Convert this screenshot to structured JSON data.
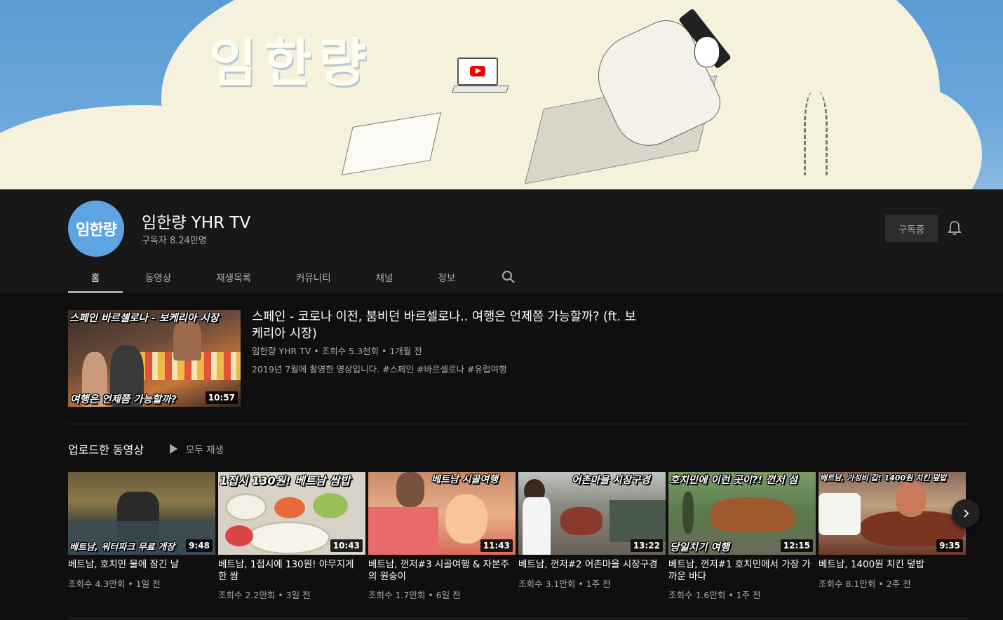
{
  "banner": {
    "title": "임한량"
  },
  "channel": {
    "avatar_text": "임한량",
    "name": "임한량 YHR TV",
    "subscribers": "구독자 8.24만명",
    "subscribe_label": "구독중"
  },
  "tabs": [
    {
      "label": "홈",
      "active": true
    },
    {
      "label": "동영상"
    },
    {
      "label": "재생목록"
    },
    {
      "label": "커뮤니티"
    },
    {
      "label": "채널"
    },
    {
      "label": "정보"
    }
  ],
  "featured": {
    "thumb_top": "스페인 바르셀로나 - 보케리아 시장",
    "thumb_bottom": "여행은 언제쯤 가능할까?",
    "duration": "10:57",
    "title": "스페인 - 코로나 이전, 붐비던 바르셀로나.. 여행은 언제쯤 가능할까? (ft. 보케리아 시장)",
    "meta": "임한량 YHR TV • 조회수 5.3천회 • 1개월 전",
    "description": "2019년 7월에 촬영한 영상입니다. #스페인 #바르셀로나 #유럽여행"
  },
  "shelf": {
    "title": "업로드한 동영상",
    "play_all": "모두 재생"
  },
  "videos": [
    {
      "caption": "베트남, 워터파크 무료 개장",
      "caption_pos": "bottom",
      "duration": "9:48",
      "title": "베트남, 호치민 물에 잠긴 날",
      "meta": "조회수 4.3만회 • 1일 전"
    },
    {
      "caption": "1접시 130원! 베트남 쌈밥",
      "caption_pos": "top",
      "duration": "10:43",
      "title": "베트남, 1접시에 130원! 야무지게 한 쌈",
      "meta": "조회수 2.2만회 • 3일 전"
    },
    {
      "caption": "베트남 시골여행",
      "caption_pos": "top",
      "duration": "11:43",
      "title": "베트남, 껀저#3 시골여행 & 자본주의 원숭이",
      "meta": "조회수 1.7만회 • 6일 전"
    },
    {
      "caption": "어촌마을 시장구경",
      "caption_pos": "top",
      "duration": "13:22",
      "title": "베트남, 껀저#2 어촌마을 시장구경",
      "meta": "조회수 3.1만회 • 1주 전"
    },
    {
      "caption": "호치민에 이런 곳이?! 껀저 섬",
      "caption2": "당일치기 여행",
      "caption_pos": "both",
      "duration": "12:15",
      "title": "베트남, 껀저#1 호치민에서 가장 가까운 바다",
      "meta": "조회수 1.6만회 • 1주 전"
    },
    {
      "caption": "베트남, 가성비 갑! 1400원 치킨 덮밥",
      "caption_pos": "top",
      "duration": "9:35",
      "title": "베트남, 1400원 치킨 덮밥",
      "meta": "조회수 8.1만회 • 2주 전"
    }
  ]
}
